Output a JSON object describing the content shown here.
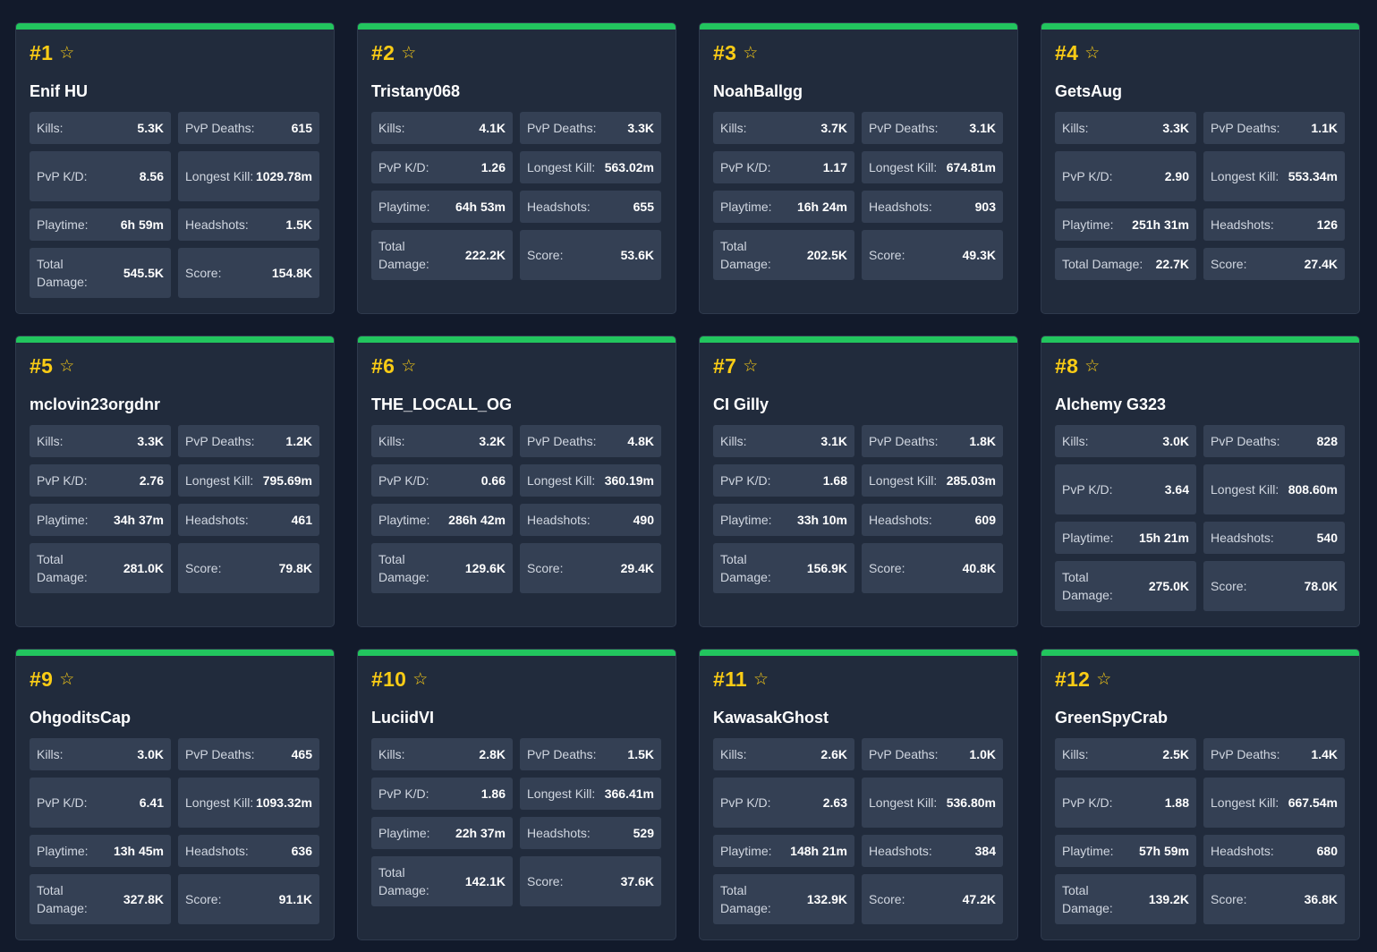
{
  "labels": {
    "kills": "Kills:",
    "pvp_deaths": "PvP Deaths:",
    "pvp_kd": "PvP K/D:",
    "longest_kill": "Longest Kill:",
    "playtime": "Playtime:",
    "headshots": "Headshots:",
    "total_damage": "Total Damage:",
    "score": "Score:"
  },
  "colors": {
    "background": "#121a2b",
    "card": "#212b3c",
    "stat_box": "#344054",
    "accent_bar": "#22c55e",
    "rank": "#facc15"
  },
  "star_icon": "star-outline-icon",
  "players": [
    {
      "rank": "#1",
      "name": "Enif HU",
      "kills": "5.3K",
      "pvp_deaths": "615",
      "pvp_kd": "8.56",
      "longest_kill": "1029.78m",
      "playtime": "6h 59m",
      "headshots": "1.5K",
      "total_damage": "545.5K",
      "score": "154.8K"
    },
    {
      "rank": "#2",
      "name": "Tristany068",
      "kills": "4.1K",
      "pvp_deaths": "3.3K",
      "pvp_kd": "1.26",
      "longest_kill": "563.02m",
      "playtime": "64h 53m",
      "headshots": "655",
      "total_damage": "222.2K",
      "score": "53.6K"
    },
    {
      "rank": "#3",
      "name": "NoahBallgg",
      "kills": "3.7K",
      "pvp_deaths": "3.1K",
      "pvp_kd": "1.17",
      "longest_kill": "674.81m",
      "playtime": "16h 24m",
      "headshots": "903",
      "total_damage": "202.5K",
      "score": "49.3K"
    },
    {
      "rank": "#4",
      "name": "GetsAug",
      "kills": "3.3K",
      "pvp_deaths": "1.1K",
      "pvp_kd": "2.90",
      "longest_kill": "553.34m",
      "playtime": "251h 31m",
      "headshots": "126",
      "total_damage": "22.7K",
      "score": "27.4K"
    },
    {
      "rank": "#5",
      "name": "mclovin23orgdnr",
      "kills": "3.3K",
      "pvp_deaths": "1.2K",
      "pvp_kd": "2.76",
      "longest_kill": "795.69m",
      "playtime": "34h 37m",
      "headshots": "461",
      "total_damage": "281.0K",
      "score": "79.8K"
    },
    {
      "rank": "#6",
      "name": "THE_LOCALL_OG",
      "kills": "3.2K",
      "pvp_deaths": "4.8K",
      "pvp_kd": "0.66",
      "longest_kill": "360.19m",
      "playtime": "286h 42m",
      "headshots": "490",
      "total_damage": "129.6K",
      "score": "29.4K"
    },
    {
      "rank": "#7",
      "name": "CI Gilly",
      "kills": "3.1K",
      "pvp_deaths": "1.8K",
      "pvp_kd": "1.68",
      "longest_kill": "285.03m",
      "playtime": "33h 10m",
      "headshots": "609",
      "total_damage": "156.9K",
      "score": "40.8K"
    },
    {
      "rank": "#8",
      "name": "Alchemy G323",
      "kills": "3.0K",
      "pvp_deaths": "828",
      "pvp_kd": "3.64",
      "longest_kill": "808.60m",
      "playtime": "15h 21m",
      "headshots": "540",
      "total_damage": "275.0K",
      "score": "78.0K"
    },
    {
      "rank": "#9",
      "name": "OhgoditsCap",
      "kills": "3.0K",
      "pvp_deaths": "465",
      "pvp_kd": "6.41",
      "longest_kill": "1093.32m",
      "playtime": "13h 45m",
      "headshots": "636",
      "total_damage": "327.8K",
      "score": "91.1K"
    },
    {
      "rank": "#10",
      "name": "LuciidVI",
      "kills": "2.8K",
      "pvp_deaths": "1.5K",
      "pvp_kd": "1.86",
      "longest_kill": "366.41m",
      "playtime": "22h 37m",
      "headshots": "529",
      "total_damage": "142.1K",
      "score": "37.6K"
    },
    {
      "rank": "#11",
      "name": "KawasakGhost",
      "kills": "2.6K",
      "pvp_deaths": "1.0K",
      "pvp_kd": "2.63",
      "longest_kill": "536.80m",
      "playtime": "148h 21m",
      "headshots": "384",
      "total_damage": "132.9K",
      "score": "47.2K"
    },
    {
      "rank": "#12",
      "name": "GreenSpyCrab",
      "kills": "2.5K",
      "pvp_deaths": "1.4K",
      "pvp_kd": "1.88",
      "longest_kill": "667.54m",
      "playtime": "57h 59m",
      "headshots": "680",
      "total_damage": "139.2K",
      "score": "36.8K"
    }
  ]
}
